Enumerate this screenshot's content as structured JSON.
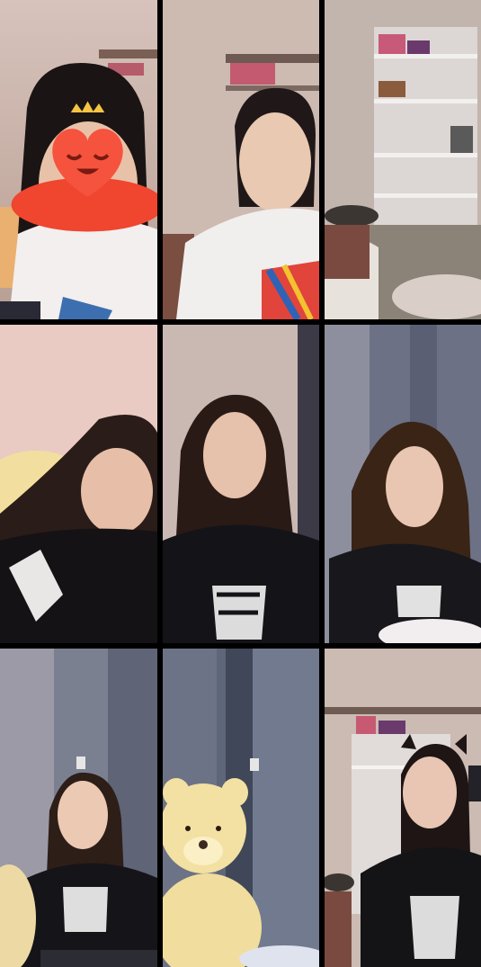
{
  "layout": {
    "type": "video-grid",
    "columns": 3,
    "rows": 3,
    "background": "#000000"
  },
  "tiles": [
    {
      "id": "tile-1",
      "subject": "person-white-tshirt",
      "bg": "#d9c6be",
      "effect": "heart-crown-face-filter"
    },
    {
      "id": "tile-2",
      "subject": "person-white-tshirt",
      "bg": "#c9b6ad"
    },
    {
      "id": "tile-3",
      "subject": "empty-room-shelves",
      "bg": "#b9aca6"
    },
    {
      "id": "tile-4",
      "subject": "person-black-shirt-lying",
      "bg": "#e7c9c1"
    },
    {
      "id": "tile-5",
      "subject": "person-black-shirt",
      "bg": "#c4b3ad"
    },
    {
      "id": "tile-6",
      "subject": "person-black-shirt-curtain",
      "bg": "#6a6f82"
    },
    {
      "id": "tile-7",
      "subject": "person-black-shirt-curtain",
      "bg": "#737889"
    },
    {
      "id": "tile-8",
      "subject": "teddy-bear-curtain",
      "bg": "#5e6679"
    },
    {
      "id": "tile-9",
      "subject": "person-black-shirt-shelves",
      "bg": "#c8b7ad",
      "effect": "cat-ears-filter"
    }
  ]
}
